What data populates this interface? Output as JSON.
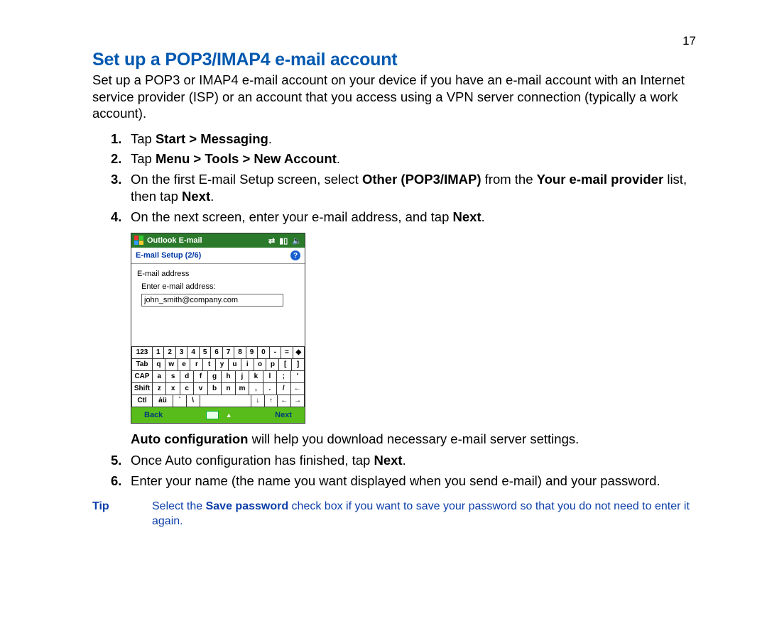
{
  "pageNumber": "17",
  "title": "Set up a POP3/IMAP4 e-mail account",
  "intro": "Set up a POP3 or IMAP4 e-mail account on your device if you have an e-mail account with an Internet service provider (ISP) or an account that you access using a VPN server connection (typically a work account).",
  "steps": {
    "s1_pre": "Tap ",
    "s1_bold": "Start > Messaging",
    "s1_post": ".",
    "s2_pre": "Tap ",
    "s2_bold": "Menu > Tools > New Account",
    "s2_post": ".",
    "s3_pre": "On the first E-mail Setup screen, select ",
    "s3_bold1": "Other (POP3/IMAP)",
    "s3_mid": " from the ",
    "s3_bold2": "Your e-mail provider",
    "s3_post1": " list, then tap ",
    "s3_bold3": "Next",
    "s3_post2": ".",
    "s4_pre": "On the next screen, enter your e-mail address, and tap ",
    "s4_bold": "Next",
    "s4_post": ".",
    "s5_pre": "Once Auto configuration has finished, tap ",
    "s5_bold": "Next",
    "s5_post": ".",
    "s6": "Enter your name (the name you want displayed when you send e-mail) and your password."
  },
  "autoconf_bold": "Auto configuration",
  "autoconf_rest": " will help you download necessary e-mail server settings.",
  "tip": {
    "label": "Tip",
    "pre": "Select the ",
    "bold": "Save password",
    "post": " check box if you want to save your password so that you do not need to enter it again."
  },
  "mock": {
    "title": "Outlook E-mail",
    "setupStep": "E-mail Setup (2/6)",
    "label1": "E-mail address",
    "label2": "Enter e-mail address:",
    "inputValue": "john_smith@company.com",
    "soft_left": "Back",
    "soft_right": "Next",
    "kb": {
      "r1": [
        "123",
        "1",
        "2",
        "3",
        "4",
        "5",
        "6",
        "7",
        "8",
        "9",
        "0",
        "-",
        "=",
        "◆"
      ],
      "r2": [
        "Tab",
        "q",
        "w",
        "e",
        "r",
        "t",
        "y",
        "u",
        "i",
        "o",
        "p",
        "[",
        "]"
      ],
      "r3": [
        "CAP",
        "a",
        "s",
        "d",
        "f",
        "g",
        "h",
        "j",
        "k",
        "l",
        ";",
        "'"
      ],
      "r4": [
        "Shift",
        "z",
        "x",
        "c",
        "v",
        "b",
        "n",
        "m",
        ",",
        ".",
        "/",
        "←"
      ],
      "r5": [
        "Ctl",
        "áü",
        "`",
        "\\",
        " ",
        "↓",
        "↑",
        "←",
        "→"
      ]
    }
  }
}
